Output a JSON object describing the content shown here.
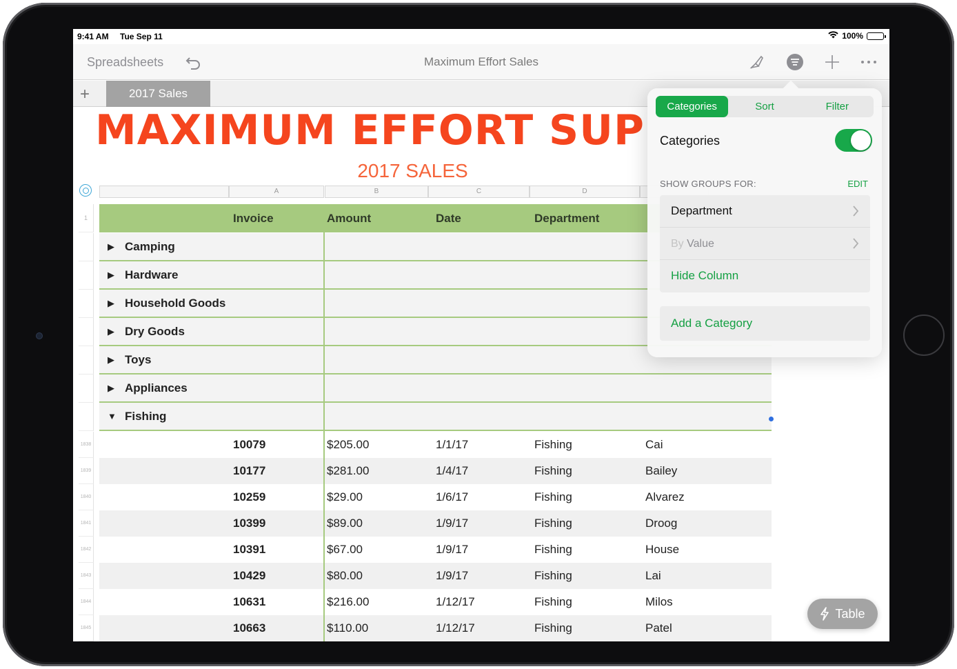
{
  "status_bar": {
    "time": "9:41 AM",
    "date": "Tue Sep 11",
    "battery": "100%"
  },
  "toolbar": {
    "back_label": "Spreadsheets",
    "title": "Maximum Effort Sales"
  },
  "tabs": {
    "active": "2017 Sales"
  },
  "sheet": {
    "title": "MAXIMUM EFFORT SUP",
    "subtitle": "2017 SALES",
    "column_letters": [
      "A",
      "B",
      "C",
      "D"
    ],
    "headers": [
      "Invoice",
      "Amount",
      "Date",
      "Department"
    ],
    "groups": [
      {
        "label": "Camping",
        "expanded": false
      },
      {
        "label": "Hardware",
        "expanded": false
      },
      {
        "label": "Household Goods",
        "expanded": false
      },
      {
        "label": "Dry Goods",
        "expanded": false
      },
      {
        "label": "Toys",
        "expanded": false
      },
      {
        "label": "Appliances",
        "expanded": false
      },
      {
        "label": "Fishing",
        "expanded": true
      }
    ],
    "row_numbers": [
      "1",
      "1838",
      "1839",
      "1840",
      "1841",
      "1842",
      "1843",
      "1844",
      "1845"
    ],
    "rows": [
      {
        "invoice": "10079",
        "amount": "$205.00",
        "date": "1/1/17",
        "department": "Fishing",
        "name": "Cai"
      },
      {
        "invoice": "10177",
        "amount": "$281.00",
        "date": "1/4/17",
        "department": "Fishing",
        "name": "Bailey"
      },
      {
        "invoice": "10259",
        "amount": "$29.00",
        "date": "1/6/17",
        "department": "Fishing",
        "name": "Alvarez"
      },
      {
        "invoice": "10399",
        "amount": "$89.00",
        "date": "1/9/17",
        "department": "Fishing",
        "name": "Droog"
      },
      {
        "invoice": "10391",
        "amount": "$67.00",
        "date": "1/9/17",
        "department": "Fishing",
        "name": "House"
      },
      {
        "invoice": "10429",
        "amount": "$80.00",
        "date": "1/9/17",
        "department": "Fishing",
        "name": "Lai"
      },
      {
        "invoice": "10631",
        "amount": "$216.00",
        "date": "1/12/17",
        "department": "Fishing",
        "name": "Milos"
      },
      {
        "invoice": "10663",
        "amount": "$110.00",
        "date": "1/12/17",
        "department": "Fishing",
        "name": "Patel"
      }
    ]
  },
  "popover": {
    "segments": [
      "Categories",
      "Sort",
      "Filter"
    ],
    "active_segment": "Categories",
    "toggle_label": "Categories",
    "toggle_on": true,
    "section_label": "SHOW GROUPS FOR:",
    "edit_label": "EDIT",
    "group_by": "Department",
    "by_prefix": "By",
    "by_value": "Value",
    "hide_column": "Hide Column",
    "add_category": "Add a Category"
  },
  "fab": {
    "label": "Table"
  },
  "colors": {
    "accent_green": "#18a84a",
    "header_green": "#a6ca7f",
    "title_orange": "#f5451e"
  },
  "icons": [
    "undo-icon",
    "format-brush-icon",
    "organize-icon",
    "add-icon",
    "more-icon",
    "wifi-icon",
    "battery-icon",
    "chevron-right-icon",
    "lightning-icon"
  ]
}
